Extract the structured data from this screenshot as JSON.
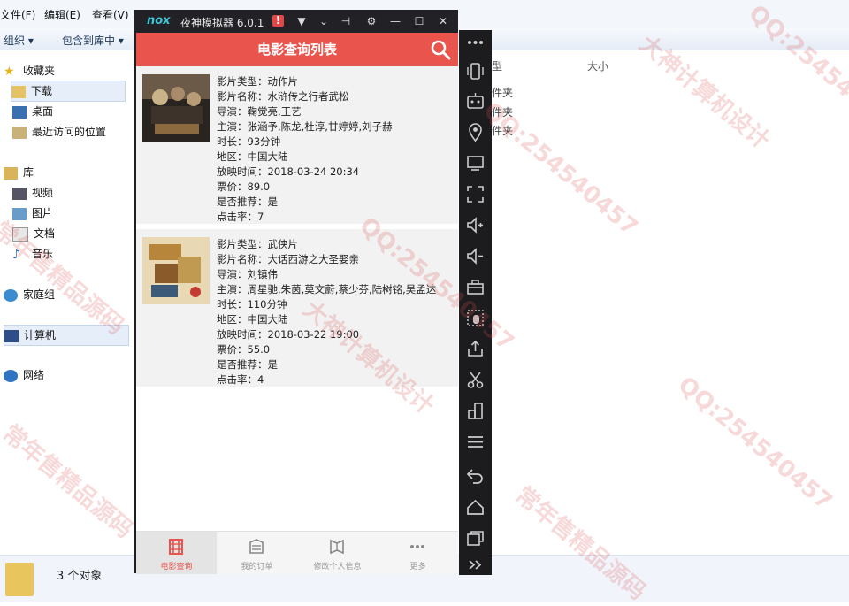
{
  "explorer": {
    "menu": [
      "文件(F)",
      "编辑(E)",
      "查看(V)"
    ],
    "toolbar": {
      "organize": "组织 ▾",
      "include": "包含到库中 ▾"
    },
    "nav": {
      "favorites": "收藏夹",
      "downloads": "下载",
      "desktop": "桌面",
      "recent": "最近访问的位置",
      "libraries": "库",
      "videos": "视频",
      "pictures": "图片",
      "documents": "文档",
      "music": "音乐",
      "homegroup": "家庭组",
      "computer": "计算机",
      "network": "网络"
    },
    "columns": {
      "type": "型",
      "size": "大小"
    },
    "row_type": [
      "件夹",
      "件夹",
      "件夹"
    ],
    "status": "3 个对象"
  },
  "emulator": {
    "logo": "nox",
    "title": "夜神模拟器 6.0.1"
  },
  "app": {
    "title": "电影查询列表",
    "movies": [
      {
        "type": "影片类型：动作片",
        "name": "影片名称：水浒传之行者武松",
        "director": "导演：鞠觉亮,王艺",
        "cast": "主演：张涵予,陈龙,杜淳,甘婷婷,刘子赫",
        "duration": "时长：93分钟",
        "region": "地区：中国大陆",
        "showtime": "放映时间：2018-03-24 20:34",
        "price": "票价：89.0",
        "recommend": "是否推荐：是",
        "clicks": "点击率：7",
        "poster_colors": [
          "#2a2420",
          "#6b5a48",
          "#c9b48a"
        ]
      },
      {
        "type": "影片类型：武侠片",
        "name": "影片名称：大话西游之大圣娶亲",
        "director": "导演：刘镇伟",
        "cast": "主演：周星驰,朱茵,莫文蔚,蔡少芬,陆树铭,吴孟达",
        "duration": "时长：110分钟",
        "region": "地区：中国大陆",
        "showtime": "放映时间：2018-03-22 19:00",
        "price": "票价：55.0",
        "recommend": "是否推荐：是",
        "clicks": "点击率：4",
        "poster_colors": [
          "#e8d8b4",
          "#b8863a",
          "#3b5a7a"
        ]
      }
    ],
    "tabs": [
      {
        "label": "电影查询",
        "icon": "film-icon"
      },
      {
        "label": "我的订单",
        "icon": "order-icon"
      },
      {
        "label": "修改个人信息",
        "icon": "book-icon"
      },
      {
        "label": "更多",
        "icon": "more-icon"
      }
    ],
    "accent": "#e9544c"
  },
  "watermarks": [
    "QQ:254540457",
    "大神计算机设计",
    "常年售精品源码"
  ]
}
